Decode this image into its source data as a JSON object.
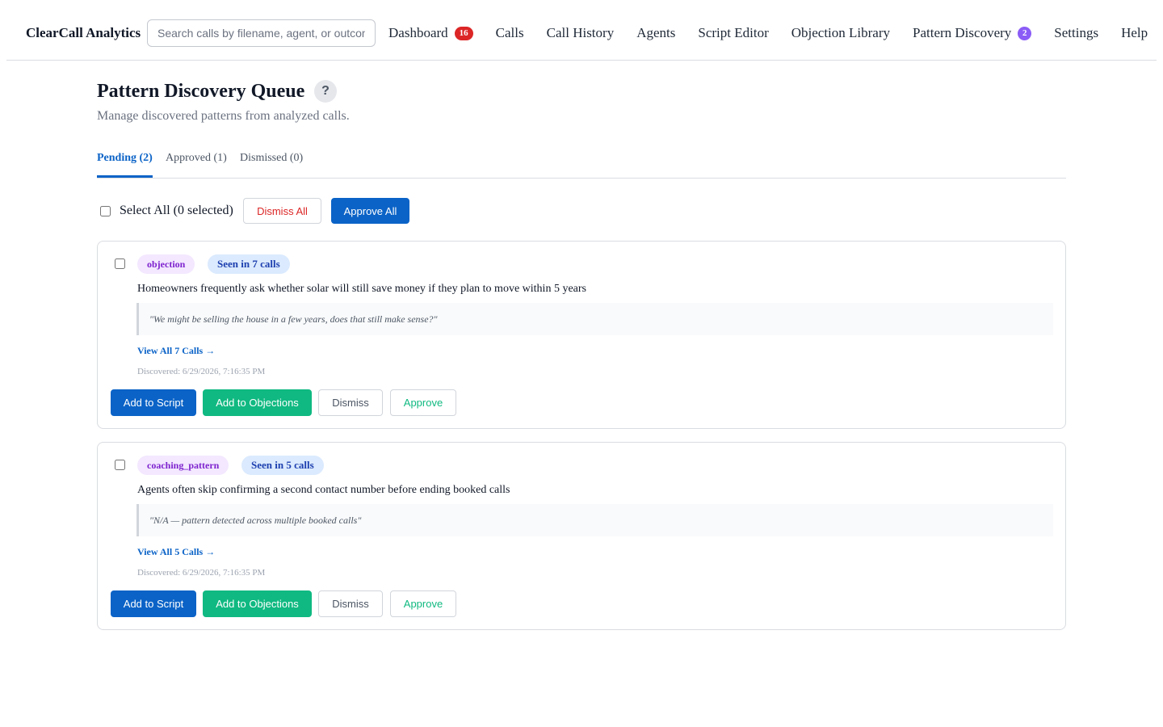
{
  "app": {
    "brand": "ClearCall Analytics"
  },
  "search": {
    "placeholder": "Search calls by filename, agent, or outcome"
  },
  "nav": {
    "dashboard": {
      "label": "Dashboard",
      "badge": "16",
      "badge_color": "#dc2626"
    },
    "calls": "Calls",
    "call_history": "Call History",
    "agents": "Agents",
    "script_editor": "Script Editor",
    "objection_library": "Objection Library",
    "pattern_discovery": {
      "label": "Pattern Discovery",
      "badge": "2",
      "badge_color": "#8b5cf6"
    },
    "settings": "Settings",
    "help": "Help"
  },
  "header": {
    "title": "Pattern Discovery Queue",
    "help_icon": "?",
    "subtitle": "Manage discovered patterns from analyzed calls."
  },
  "tabs": [
    {
      "label": "Pending (2)",
      "active": true
    },
    {
      "label": "Approved (1)",
      "active": false
    },
    {
      "label": "Dismissed (0)",
      "active": false
    }
  ],
  "bulk": {
    "select_all_label": "Select All (0 selected)",
    "dismiss_all": "Dismiss All",
    "approve_all": "Approve All"
  },
  "patterns": [
    {
      "type": "objection",
      "seen": "Seen in 7 calls",
      "description": "Homeowners frequently ask whether solar will still save money if they plan to move within 5 years",
      "quote": "\"We might be selling the house in a few years, does that still make sense?\"",
      "view_link": "View All 7 Calls →",
      "discovered": "Discovered: 6/29/2026, 7:16:35 PM",
      "actions": {
        "add_script": "Add to Script",
        "add_objections": "Add to Objections",
        "dismiss": "Dismiss",
        "approve": "Approve"
      }
    },
    {
      "type": "coaching_pattern",
      "seen": "Seen in 5 calls",
      "description": "Agents often skip confirming a second contact number before ending booked calls",
      "quote": "\"N/A — pattern detected across multiple booked calls\"",
      "view_link": "View All 5 Calls →",
      "discovered": "Discovered: 6/29/2026, 7:16:35 PM",
      "actions": {
        "add_script": "Add to Script",
        "add_objections": "Add to Objections",
        "dismiss": "Dismiss",
        "approve": "Approve"
      }
    }
  ],
  "colors": {
    "primary": "#0b63c7",
    "success": "#10b981",
    "danger": "#dc2626",
    "type_tag_bg": "#f3e8ff",
    "seen_tag_bg": "#dbeafe"
  }
}
